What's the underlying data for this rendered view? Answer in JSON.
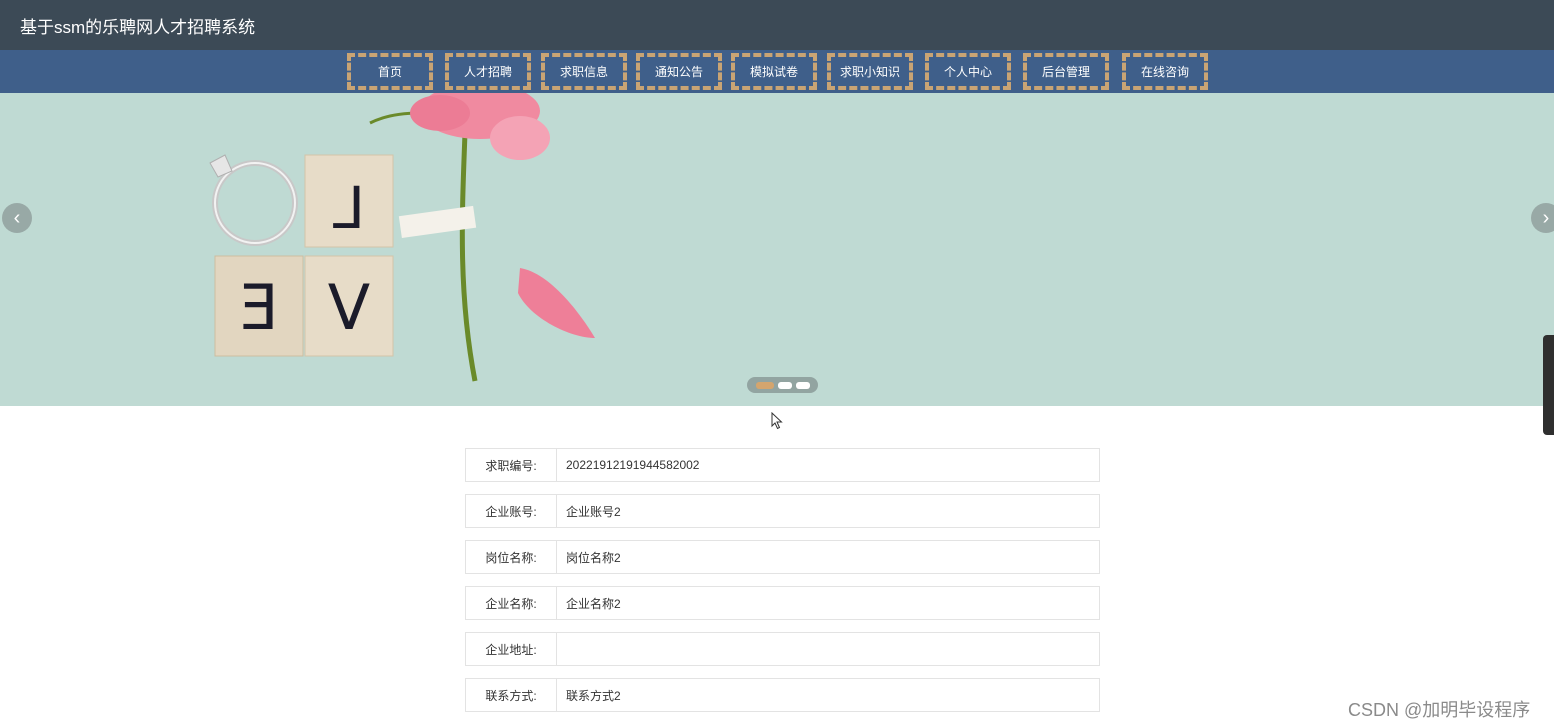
{
  "header": {
    "title": "基于ssm的乐聘网人才招聘系统"
  },
  "nav": {
    "items": [
      "首页",
      "人才招聘",
      "求职信息",
      "通知公告",
      "模拟试卷",
      "求职小知识",
      "个人中心",
      "后台管理",
      "在线咨询"
    ]
  },
  "banner": {
    "prev_icon": "chevron-left-icon",
    "next_icon": "chevron-right-icon",
    "slides": 3,
    "active_slide": 1
  },
  "form": {
    "rows": [
      {
        "label": "求职编号:",
        "value": "20221912191944582002"
      },
      {
        "label": "企业账号:",
        "value": "企业账号2"
      },
      {
        "label": "岗位名称:",
        "value": "岗位名称2"
      },
      {
        "label": "企业名称:",
        "value": "企业名称2"
      },
      {
        "label": "企业地址:",
        "value": ""
      },
      {
        "label": "联系方式:",
        "value": "联系方式2"
      }
    ]
  },
  "watermark": {
    "text": "CSDN @加明毕设程序"
  },
  "colors": {
    "topbar": "#3c4a56",
    "navbar": "#3f5f8a",
    "nav_border": "#c9a474",
    "banner_bg": "#bfdad3"
  }
}
